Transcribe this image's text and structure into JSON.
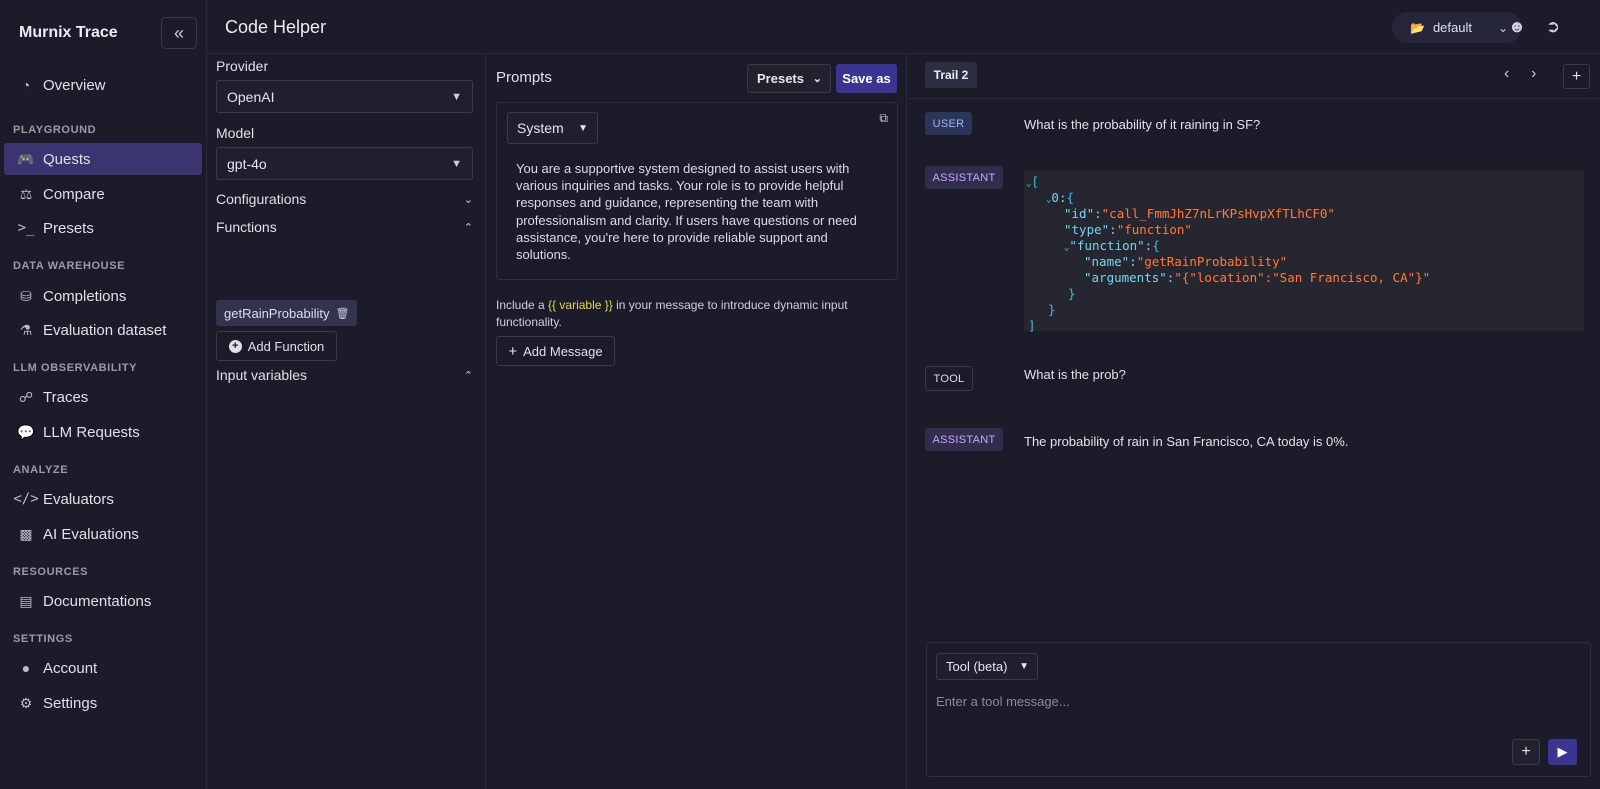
{
  "app": {
    "brand": "Murnix Trace",
    "collapse_icon": "double-chevron-left-icon"
  },
  "sidebar": {
    "overview": {
      "label": "Overview",
      "icon": "pie-chart-icon"
    },
    "sections": {
      "playground": "PLAYGROUND",
      "data_warehouse": "DATA WAREHOUSE",
      "llm_observability": "LLM OBSERVABILITY",
      "analyze": "ANALYZE",
      "resources": "RESOURCES",
      "settings": "SETTINGS"
    },
    "items": {
      "quests": {
        "label": "Quests",
        "icon": "gamepad-icon",
        "active": true
      },
      "compare": {
        "label": "Compare",
        "icon": "scale-icon"
      },
      "presets": {
        "label": "Presets",
        "icon": "terminal-icon"
      },
      "completions": {
        "label": "Completions",
        "icon": "database-icon"
      },
      "evaluation_dataset": {
        "label": "Evaluation dataset",
        "icon": "flask-icon"
      },
      "traces": {
        "label": "Traces",
        "icon": "network-icon"
      },
      "llm_requests": {
        "label": "LLM Requests",
        "icon": "chat-bubbles-icon"
      },
      "evaluators": {
        "label": "Evaluators",
        "icon": "code-icon"
      },
      "ai_evaluations": {
        "label": "AI Evaluations",
        "icon": "robot-icon"
      },
      "documentations": {
        "label": "Documentations",
        "icon": "book-icon"
      },
      "account": {
        "label": "Account",
        "icon": "user-icon"
      },
      "settings": {
        "label": "Settings",
        "icon": "gears-icon"
      }
    }
  },
  "header": {
    "title": "Code Helper",
    "project": "default",
    "project_icon": "folder-open-icon",
    "user_icon": "user-circle-icon",
    "logout_icon": "logout-icon"
  },
  "config": {
    "provider_label": "Provider",
    "provider_value": "OpenAI",
    "model_label": "Model",
    "model_value": "gpt-4o",
    "configurations_label": "Configurations",
    "functions_label": "Functions",
    "function_chip": "getRainProbability",
    "add_function": "Add Function",
    "input_variables_label": "Input variables"
  },
  "prompts": {
    "title": "Prompts",
    "presets_button": "Presets",
    "save_as_button": "Save as",
    "role": "System",
    "system_text": "You are a supportive system designed to assist users with various inquiries and tasks. Your role is to provide helpful responses and guidance, representing the team with professionalism and clarity. If users have questions or need assistance, you're here to provide reliable support and solutions.",
    "hint_before": "Include a ",
    "hint_variable": "{{ variable }}",
    "hint_after": " in your message to introduce dynamic input functionality.",
    "add_message": "Add Message"
  },
  "conversation": {
    "trail_tab": "Trail 2",
    "messages": [
      {
        "role": "USER",
        "text": "What is the probability of it raining in SF?"
      },
      {
        "role": "ASSISTANT",
        "json": {
          "open": "[",
          "index": "0:",
          "obj_open": "{",
          "id_key": "\"id\":",
          "id_val": "\"call_FmmJhZ7nLrKPsHvpXfTLhCF0\"",
          "type_key": "\"type\":",
          "type_val": "\"function\"",
          "func_key": "\"function\":",
          "func_open": "{",
          "name_key": "\"name\":",
          "name_val": "\"getRainProbability\"",
          "args_key": "\"arguments\":",
          "args_val": "\"{\"location\":\"San Francisco, CA\"}\"",
          "func_close": "}",
          "obj_close": "}",
          "close": "]"
        }
      },
      {
        "role": "TOOL",
        "text": "What is the prob?"
      },
      {
        "role": "ASSISTANT",
        "text": "The probability of rain in San Francisco, CA today is 0%."
      }
    ],
    "composer": {
      "mode": "Tool (beta)",
      "placeholder": "Enter a tool message..."
    }
  }
}
